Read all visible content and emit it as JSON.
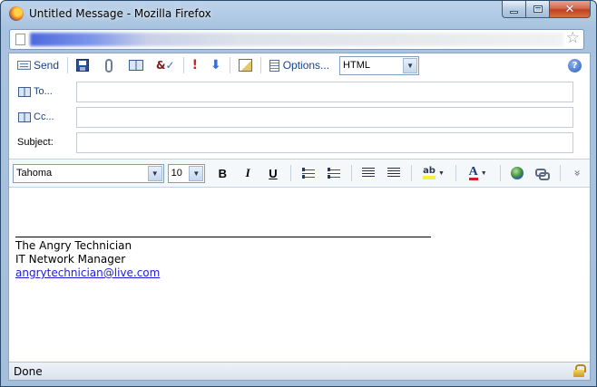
{
  "window": {
    "title": "Untitled Message - Mozilla Firefox"
  },
  "toolbar": {
    "send_label": "Send",
    "options_label": "Options...",
    "format_selected": "HTML"
  },
  "headers": {
    "to_label": "To...",
    "cc_label": "Cc...",
    "subject_label": "Subject:",
    "to_value": "",
    "cc_value": "",
    "subject_value": ""
  },
  "format_toolbar": {
    "font_name": "Tahoma",
    "font_size": "10",
    "bold": "B",
    "italic": "I",
    "underline": "U",
    "highlight_glyph": "ab",
    "font_color_glyph": "A"
  },
  "signature": {
    "name": "The Angry Technician",
    "role": "IT Network Manager",
    "email": "angrytechnician@live.com"
  },
  "status": {
    "text": "Done"
  },
  "glyphs": {
    "close": "✕",
    "star": "☆",
    "help": "?",
    "dropdown": "▼",
    "more": "»"
  }
}
